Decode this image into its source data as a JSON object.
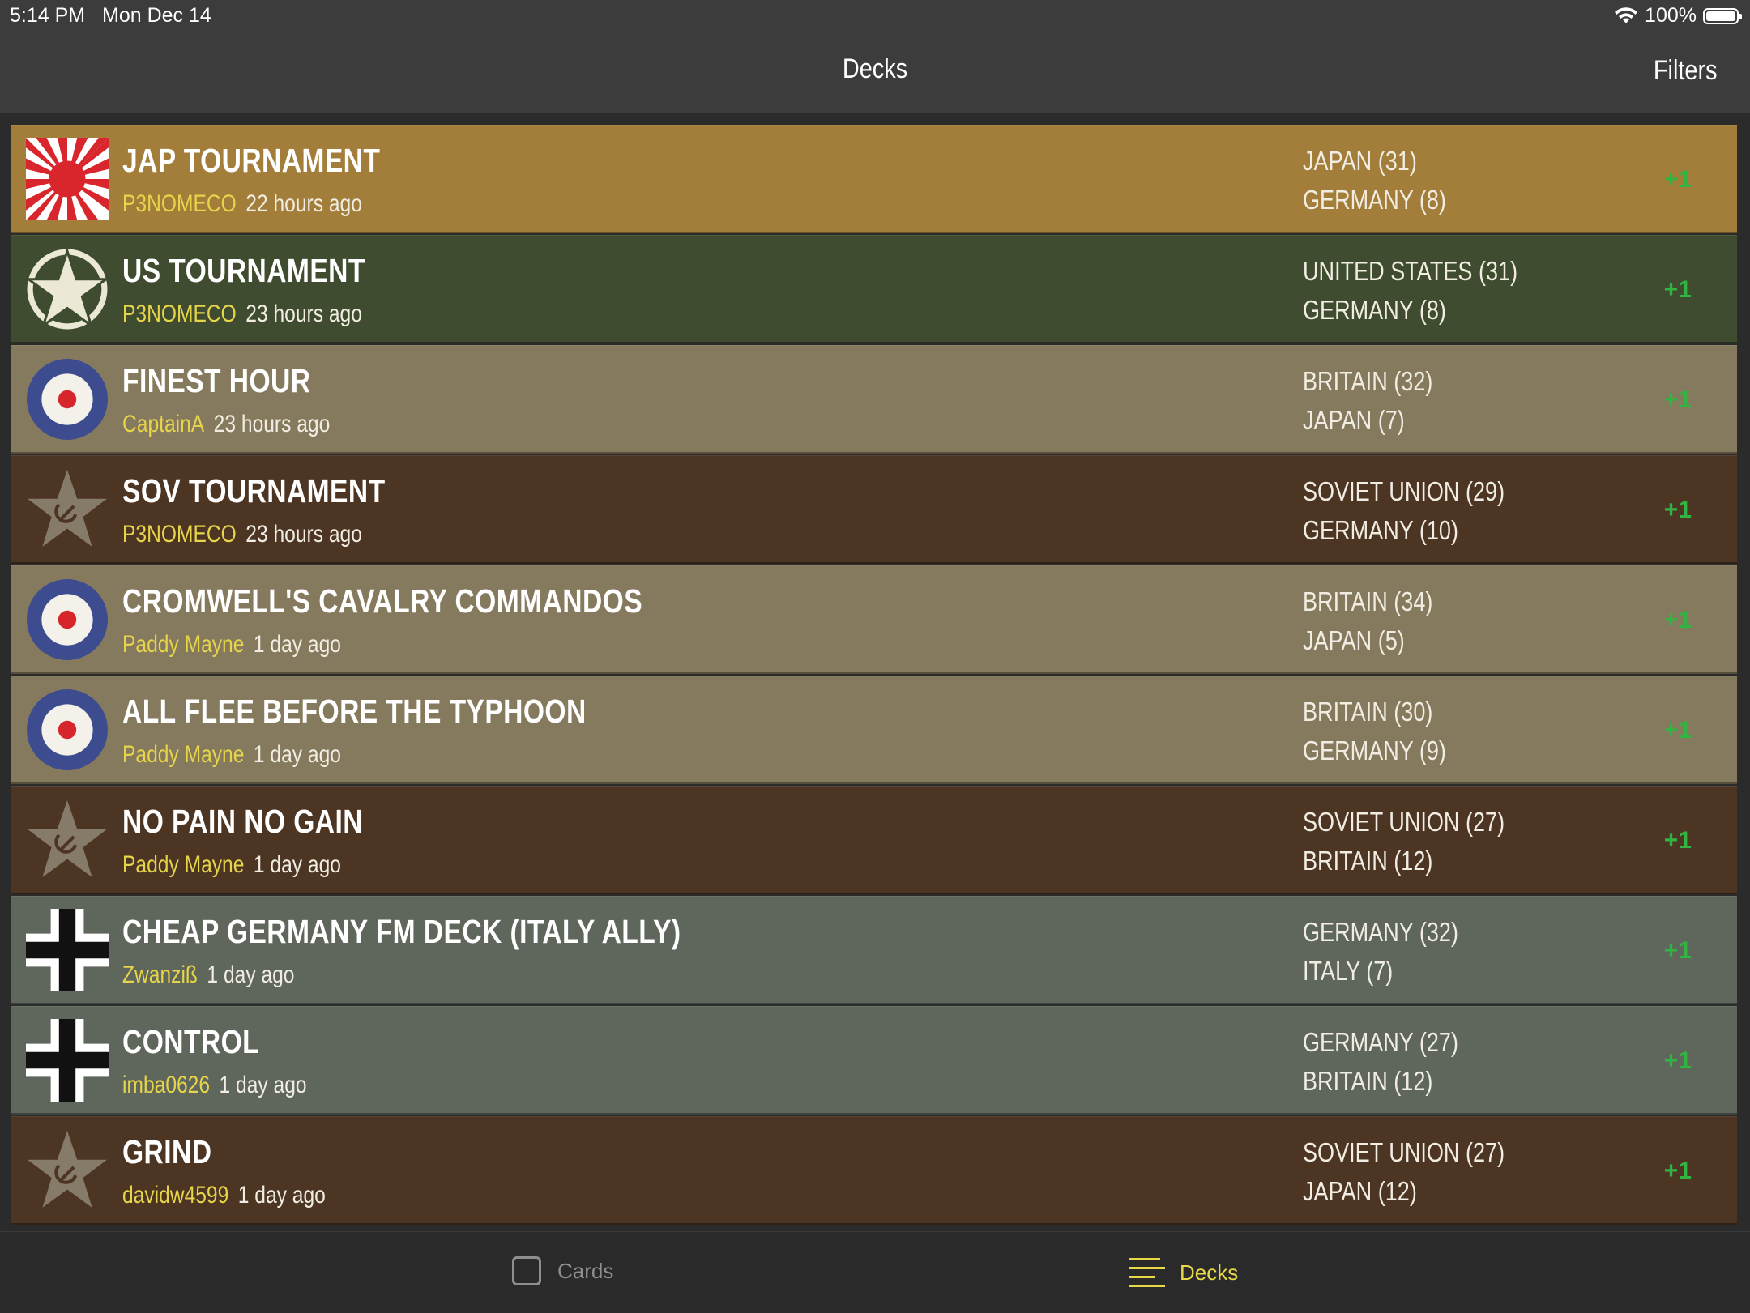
{
  "status_bar": {
    "time": "5:14 PM",
    "date": "Mon Dec 14",
    "battery": "100%"
  },
  "nav": {
    "title": "Decks",
    "filters_label": "Filters"
  },
  "decks": [
    {
      "name": "JAP TOURNAMENT",
      "author": "P3NOMECO",
      "age": "22 hours ago",
      "faction1": "JAPAN (31)",
      "faction2": "GERMANY (8)",
      "votes": "+1",
      "emblem": "japan-rising-sun-icon",
      "theme": "gold"
    },
    {
      "name": "US TOURNAMENT",
      "author": "P3NOMECO",
      "age": "23 hours ago",
      "faction1": "UNITED STATES (31)",
      "faction2": "GERMANY (8)",
      "votes": "+1",
      "emblem": "us-star-icon",
      "theme": "green"
    },
    {
      "name": "FINEST HOUR",
      "author": "CaptainA",
      "age": "23 hours ago",
      "faction1": "BRITAIN (32)",
      "faction2": "JAPAN (7)",
      "votes": "+1",
      "emblem": "raf-roundel-icon",
      "theme": "khaki"
    },
    {
      "name": "SOV TOURNAMENT",
      "author": "P3NOMECO",
      "age": "23 hours ago",
      "faction1": "SOVIET UNION (29)",
      "faction2": "GERMANY (10)",
      "votes": "+1",
      "emblem": "soviet-star-icon",
      "theme": "brown"
    },
    {
      "name": "CROMWELL'S CAVALRY COMMANDOS",
      "author": "Paddy Mayne",
      "age": "1 day ago",
      "faction1": "BRITAIN (34)",
      "faction2": "JAPAN (5)",
      "votes": "+1",
      "emblem": "raf-roundel-icon",
      "theme": "khaki"
    },
    {
      "name": "ALL FLEE BEFORE THE TYPHOON",
      "author": "Paddy Mayne",
      "age": "1 day ago",
      "faction1": "BRITAIN (30)",
      "faction2": "GERMANY (9)",
      "votes": "+1",
      "emblem": "raf-roundel-icon",
      "theme": "khaki"
    },
    {
      "name": "NO PAIN NO GAIN",
      "author": "Paddy Mayne",
      "age": "1 day ago",
      "faction1": "SOVIET UNION (27)",
      "faction2": "BRITAIN (12)",
      "votes": "+1",
      "emblem": "soviet-star-icon",
      "theme": "brown"
    },
    {
      "name": "CHEAP GERMANY FM DECK (ITALY ALLY)",
      "author": "Zwanziß",
      "age": "1 day ago",
      "faction1": "GERMANY (32)",
      "faction2": "ITALY (7)",
      "votes": "+1",
      "emblem": "german-cross-icon",
      "theme": "grey"
    },
    {
      "name": "CONTROL",
      "author": "imba0626",
      "age": "1 day ago",
      "faction1": "GERMANY (27)",
      "faction2": "BRITAIN (12)",
      "votes": "+1",
      "emblem": "german-cross-icon",
      "theme": "grey"
    },
    {
      "name": "GRIND",
      "author": "davidw4599",
      "age": "1 day ago",
      "faction1": "SOVIET UNION (27)",
      "faction2": "JAPAN (12)",
      "votes": "+1",
      "emblem": "soviet-star-icon",
      "theme": "brown"
    }
  ],
  "tabs": [
    {
      "label": "Cards",
      "icon": "square-icon",
      "active": false
    },
    {
      "label": "Decks",
      "icon": "list-lines-icon",
      "active": true
    }
  ],
  "colors": {
    "author": "#e6d44a",
    "votes": "#32b443",
    "active_tab": "#e9d847"
  }
}
